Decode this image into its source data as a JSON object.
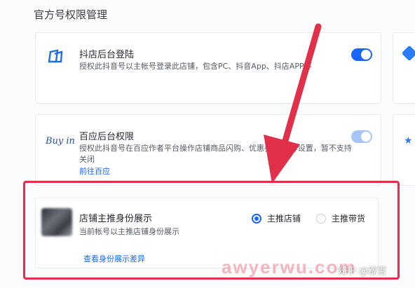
{
  "section": {
    "title": "官方号权限管理"
  },
  "cards": {
    "douyin": {
      "title": "抖店后台登陆",
      "desc": "授权此抖音号以主帐号登录此店铺，包含PC、抖音App、抖店APP等",
      "toggle_on": true
    },
    "baiying": {
      "logo_text": "Buy in",
      "title": "百应后台权限",
      "desc_line1": "授权此抖音号在百应作者平台操作店铺商品闪购、优惠券/秒杀等设置，暂不支持",
      "desc_line2": "关闭",
      "link": "前往百应",
      "toggle_on": true
    },
    "identity": {
      "title": "店铺主推身份展示",
      "desc": "当前帐号以主推店铺身份展示",
      "link": "查看身份展示差异",
      "options": [
        {
          "label": "主推店铺",
          "checked": true
        },
        {
          "label": "主推带货",
          "checked": false
        }
      ]
    }
  },
  "overlay": {
    "watermark": "awyerwu.com",
    "zhihu": "知乎 @稼雪"
  },
  "colors": {
    "accent": "#1966ff",
    "highlight": "#e0304a"
  }
}
